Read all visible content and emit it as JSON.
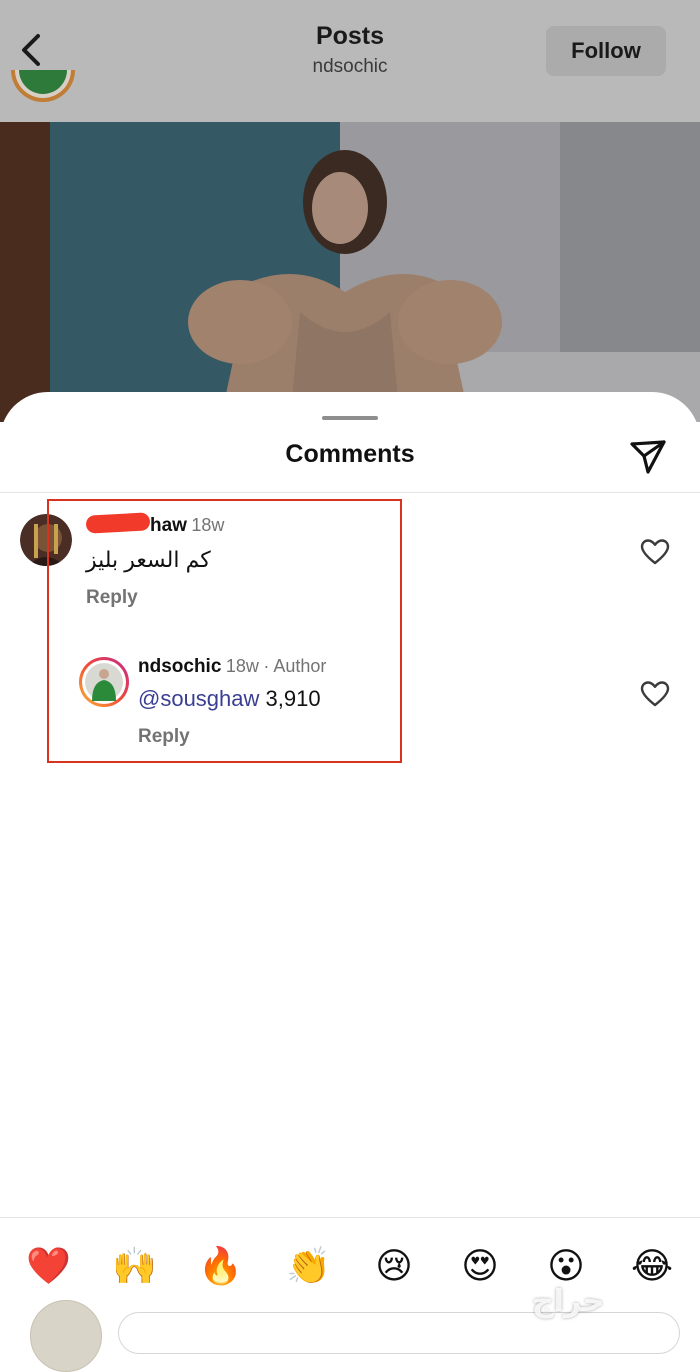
{
  "header": {
    "title": "Posts",
    "username": "ndsochic",
    "follow_label": "Follow"
  },
  "comments_sheet": {
    "title": "Comments",
    "comments": [
      {
        "username_visible": "haw",
        "time": "18w",
        "text": "كم السعر بليز",
        "reply_label": "Reply"
      },
      {
        "username": "ndsochic",
        "time": "18w",
        "author_badge": "· Author",
        "mention": "@sousghaw",
        "text": "3,910",
        "reply_label": "Reply"
      }
    ]
  },
  "emoji_bar": [
    "❤️",
    "🙌",
    "🔥",
    "👏",
    "😢",
    "😍",
    "😮",
    "😂"
  ],
  "watermark": "حراج",
  "colors": {
    "highlight_border": "#d9331f",
    "mention": "#3a3f93",
    "muted": "#737373"
  }
}
